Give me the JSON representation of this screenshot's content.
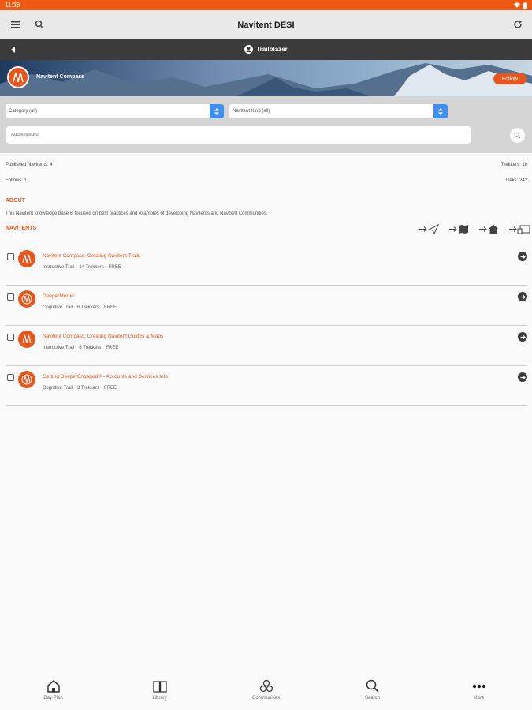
{
  "status_bar": {
    "time": "11:36"
  },
  "app_bar": {
    "title": "Navitent DESI"
  },
  "sub_bar": {
    "title": "Trailblazer"
  },
  "banner": {
    "name": "Navitent Compass",
    "follow_label": "Follow"
  },
  "filters": {
    "category": "Category (all)",
    "kind": "Navitent Kind (all)",
    "keyword_placeholder": "Add keyword"
  },
  "stats": {
    "published": "Published Navitents: 4",
    "trekkers": "Trekkers: 19",
    "follows": "Follows: 1",
    "treks": "Treks: 242"
  },
  "about": {
    "heading": "ABOUT",
    "text": "This Navitent knowledge base is focused on best practices and examples of developing Navitents and Navitent Communities."
  },
  "navitents": {
    "heading": "NAVITENTS",
    "items": [
      {
        "title": "Navitent Compass: Creating Navitent Trails",
        "type": "Instructive Trail",
        "trekkers": "14 Trekkers",
        "price": "FREE"
      },
      {
        "title": "DeeperMerrie",
        "type": "Cognitive Trail",
        "trekkers": "6 Trekkers",
        "price": "FREE"
      },
      {
        "title": "Navitent Compass: Creating Navitent Guides & Maps",
        "type": "Instructive Trail",
        "trekkers": "6 Trekkers",
        "price": "FREE"
      },
      {
        "title": "Getting DeeperEngaged® - Accounts and Services Info",
        "type": "Cognitive Trail",
        "trekkers": "3 Trekkers",
        "price": "FREE"
      }
    ]
  },
  "bottom_nav": {
    "day_plan": "Day Plan",
    "library": "Library",
    "communities": "Communities",
    "search": "Search",
    "more": "More"
  },
  "colors": {
    "accent": "#e8561c",
    "status_bar": "#ee5a14",
    "sub_bar": "#3b3b3b",
    "select_arrow": "#3d8ff5"
  }
}
